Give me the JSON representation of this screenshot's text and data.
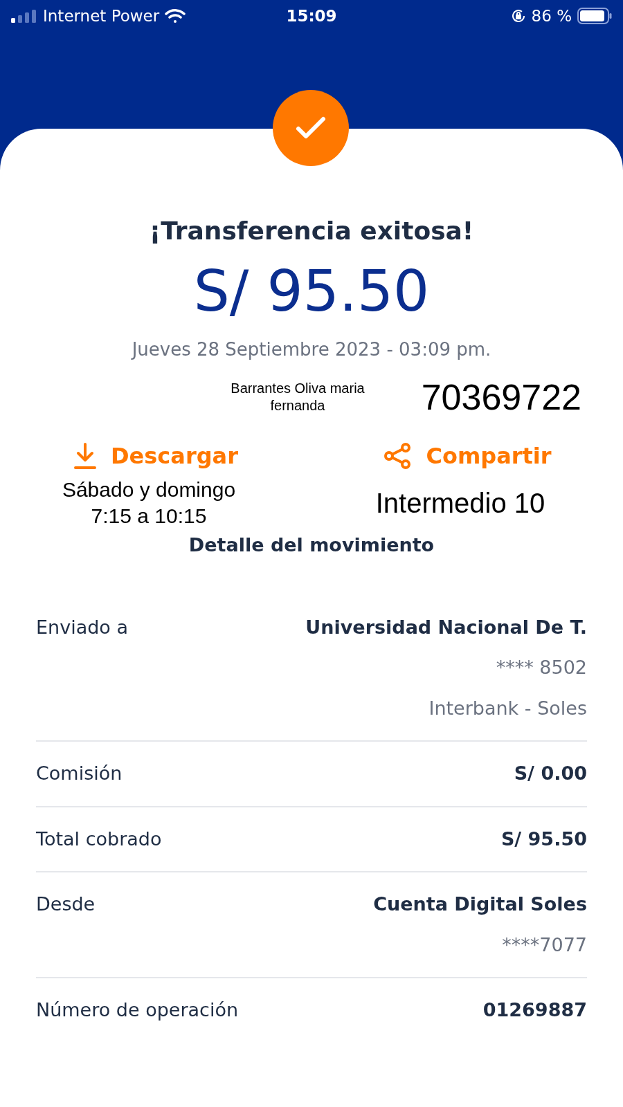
{
  "status_bar": {
    "carrier": "Internet Power",
    "time": "15:09",
    "battery": "86 %"
  },
  "success": {
    "title": "¡Transferencia exitosa!",
    "amount": "S/ 95.50",
    "date": "Jueves 28 Septiembre 2023 - 03:09 pm."
  },
  "recipient": {
    "name": "Barrantes Oliva maria fernanda",
    "number": "70369722"
  },
  "actions": [
    {
      "kind": "download",
      "label": "Descargar"
    },
    {
      "kind": "share",
      "label": "Compartir"
    }
  ],
  "schedule": {
    "lines": [
      "Sábado y domingo",
      "7:15 a 10:15"
    ],
    "level": "Intermedio 10"
  },
  "section_title": "Detalle del movimiento",
  "details": [
    {
      "label": "Enviado a",
      "value": "Universidad Nacional De T.",
      "sub": [
        "**** 8502",
        "Interbank - Soles"
      ]
    },
    {
      "label": "Comisión",
      "value": "S/ 0.00"
    },
    {
      "label": "Total cobrado",
      "value": "S/ 95.50"
    },
    {
      "label": "Desde",
      "value": "Cuenta Digital Soles",
      "sub": [
        "****7077"
      ]
    },
    {
      "label": "Número de operación",
      "value": "01269887"
    }
  ]
}
